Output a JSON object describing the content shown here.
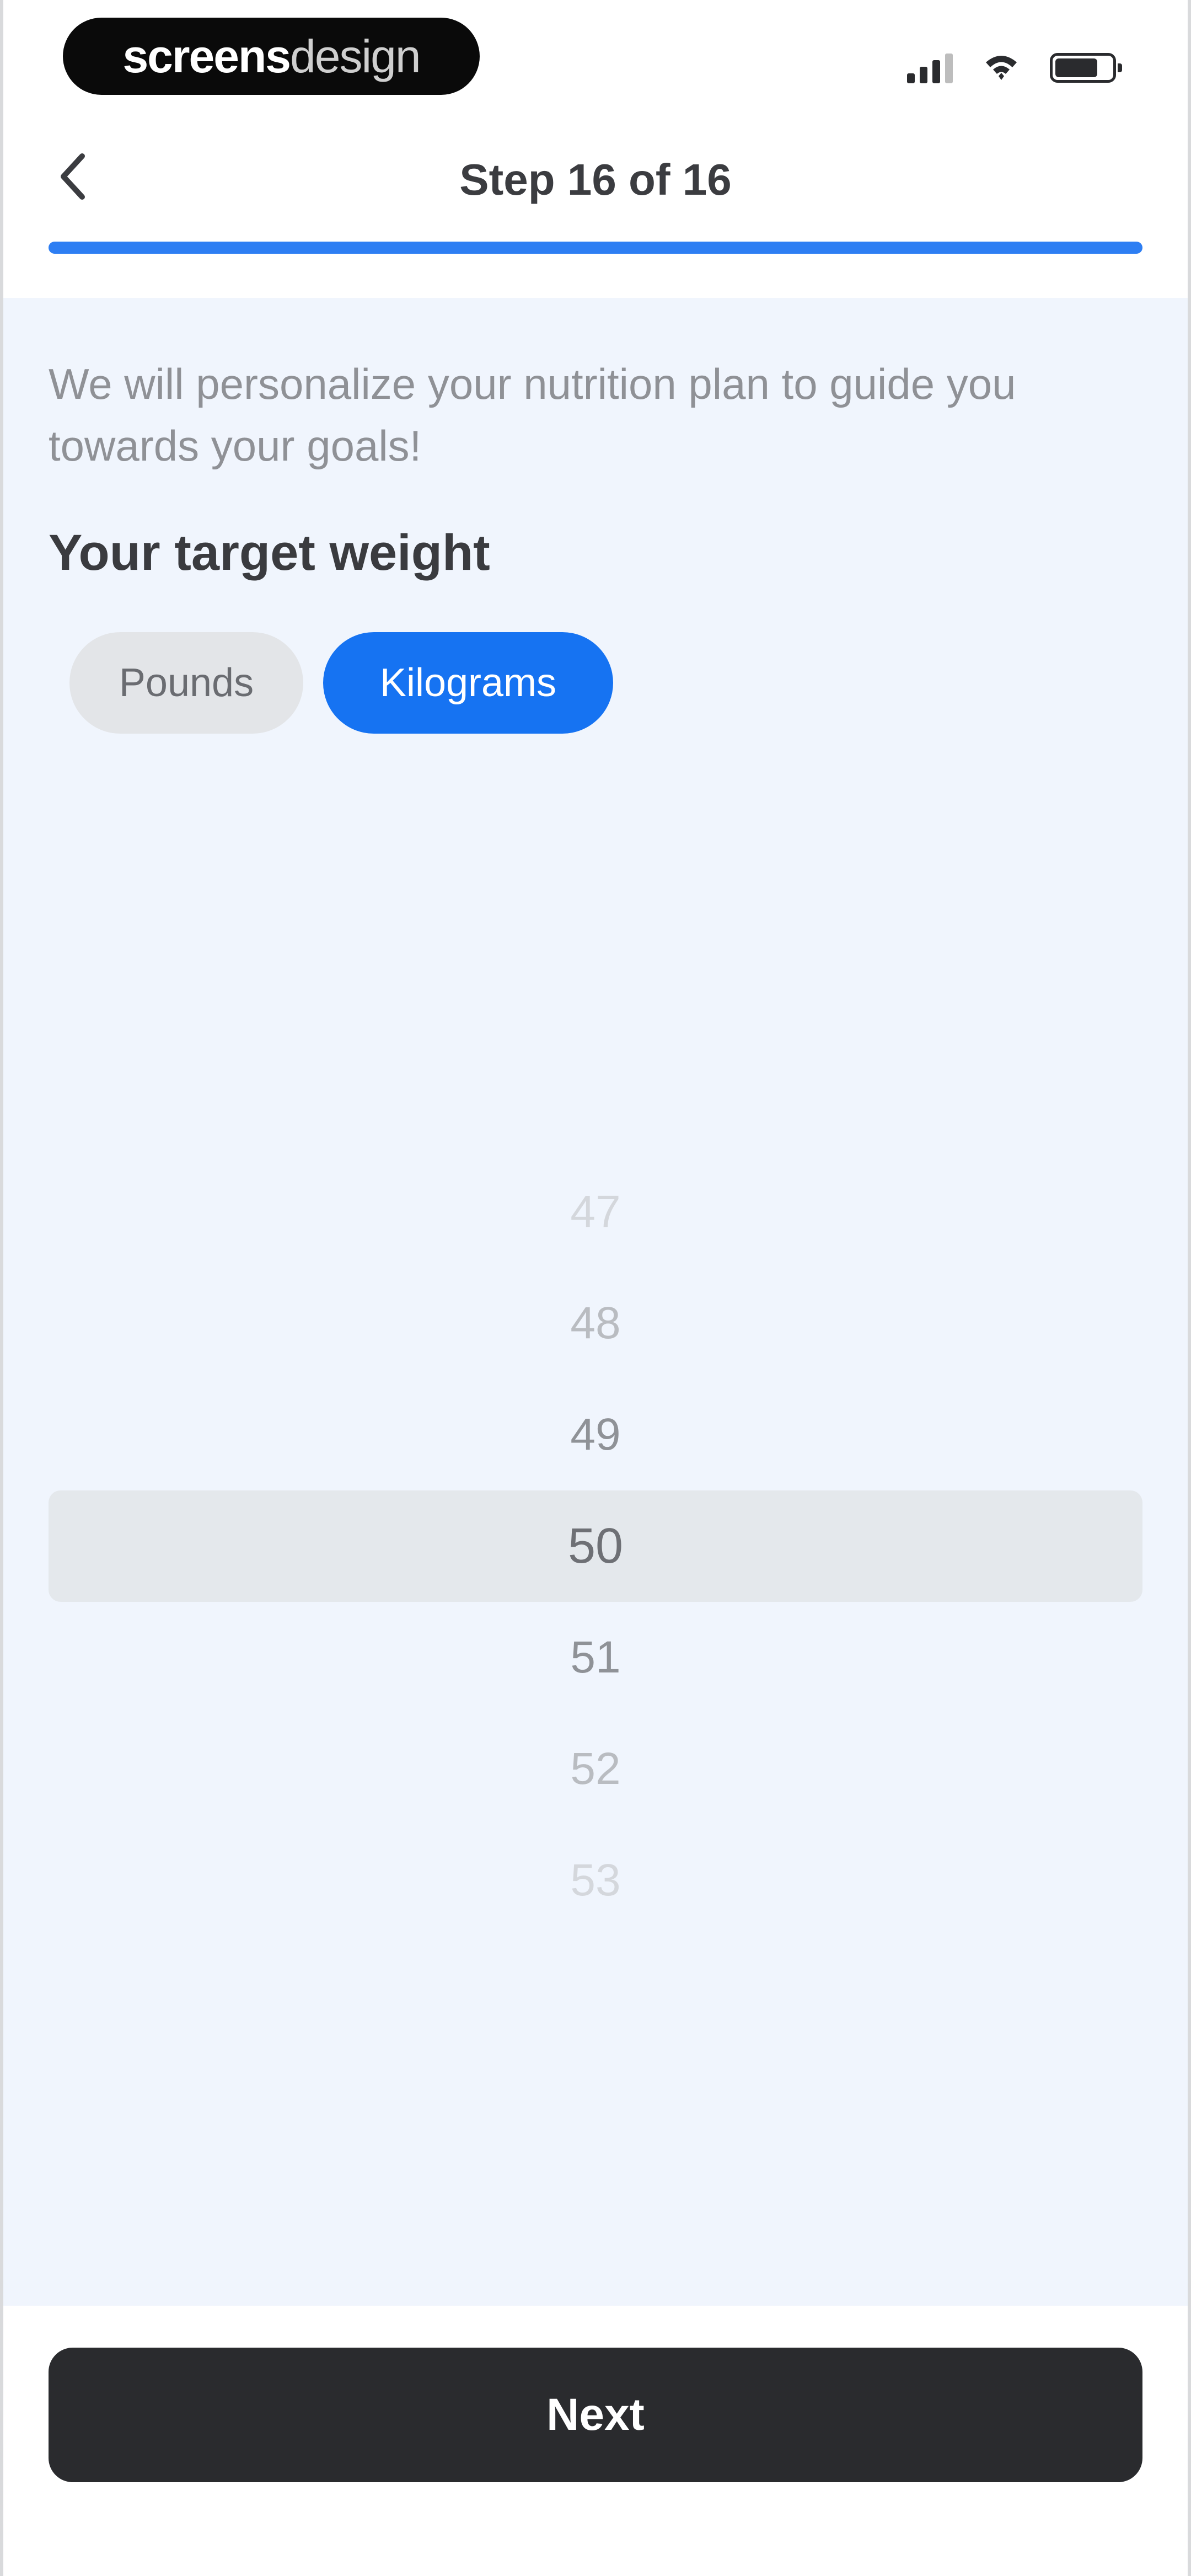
{
  "status_bar": {
    "brand_bold": "screens",
    "brand_light": "design",
    "icons": [
      "cellular-signal-icon",
      "wifi-icon",
      "battery-icon"
    ]
  },
  "header": {
    "back_icon": "chevron-left-icon",
    "title": "Step 16 of 16",
    "progress": 1.0,
    "accent_color": "#2d7ef3"
  },
  "main": {
    "intro_text": "We will personalize your nutrition plan to guide you towards your goals!",
    "section_title": "Your target weight",
    "units": [
      {
        "label": "Pounds",
        "selected": false
      },
      {
        "label": "Kilograms",
        "selected": true
      }
    ],
    "picker": {
      "values": [
        "47",
        "48",
        "49",
        "50",
        "51",
        "52",
        "53"
      ],
      "selected_value": "50"
    }
  },
  "footer": {
    "next_label": "Next"
  },
  "colors": {
    "selected_unit_bg": "#1673f2",
    "content_bg": "#f0f5fd",
    "primary_button_bg": "#2a2b2e"
  }
}
